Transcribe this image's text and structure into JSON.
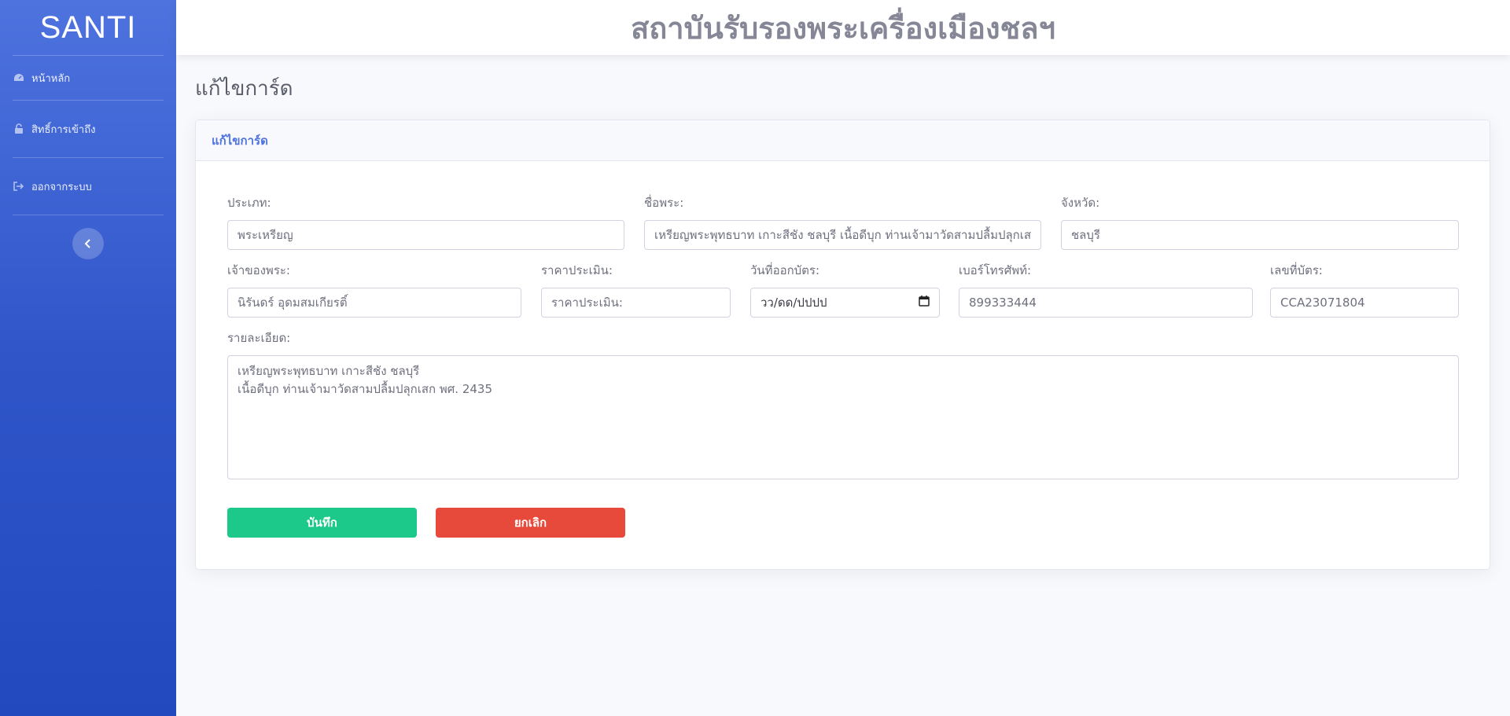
{
  "brand": "SANTI",
  "sidebar": {
    "items": [
      {
        "label": "หน้าหลัก",
        "icon": "tachometer-icon"
      },
      {
        "label": "สิทธิ์การเข้าถึง",
        "icon": "unlock-icon"
      },
      {
        "label": "ออกจากระบบ",
        "icon": "sign-out-icon"
      }
    ],
    "toggle_icon": "chevron-left-icon"
  },
  "topbar": {
    "title": "สถาบันรับรองพระเครื่องเมืองชลฯ"
  },
  "page": {
    "heading": "แก้ไขการ์ด"
  },
  "card": {
    "header": "แก้ไขการ์ด",
    "form": {
      "type": {
        "label": "ประเภท:",
        "value": "พระเหรียญ"
      },
      "name": {
        "label": "ชื่อพระ:",
        "value": "เหรียญพระพุทธบาท เกาะสีชัง ชลบุรี เนื้อดีบุก ท่านเจ้ามาวัดสามปลื้มปลุกเสก"
      },
      "province": {
        "label": "จังหวัด:",
        "value": "ชลบุรี"
      },
      "owner": {
        "label": "เจ้าของพระ:",
        "value": "นิรันดร์ อุดมสมเกียรติ์"
      },
      "price": {
        "label": "ราคาประเมิน:",
        "placeholder": "ราคาประเมิน:"
      },
      "issue_date": {
        "label": "วันที่ออกบัตร:",
        "value": "วว/ดด/ปปปป"
      },
      "phone": {
        "label": "เบอร์โทรศัพท์:",
        "value": "899333444"
      },
      "card_no": {
        "label": "เลขที่บัตร:",
        "value": "CCA23071804"
      },
      "details": {
        "label": "รายละเอียด:",
        "value": "เหรียญพระพุทธบาท เกาะสีชัง ชลบุรี\nเนื้อดีบุก ท่านเจ้ามาวัดสามปลื้มปลุกเสก พศ. 2435"
      }
    },
    "buttons": {
      "save": "บันทึก",
      "cancel": "ยกเลิก"
    }
  },
  "colors": {
    "primary": "#4e73df",
    "success": "#1cc88a",
    "danger": "#e74a3b"
  }
}
